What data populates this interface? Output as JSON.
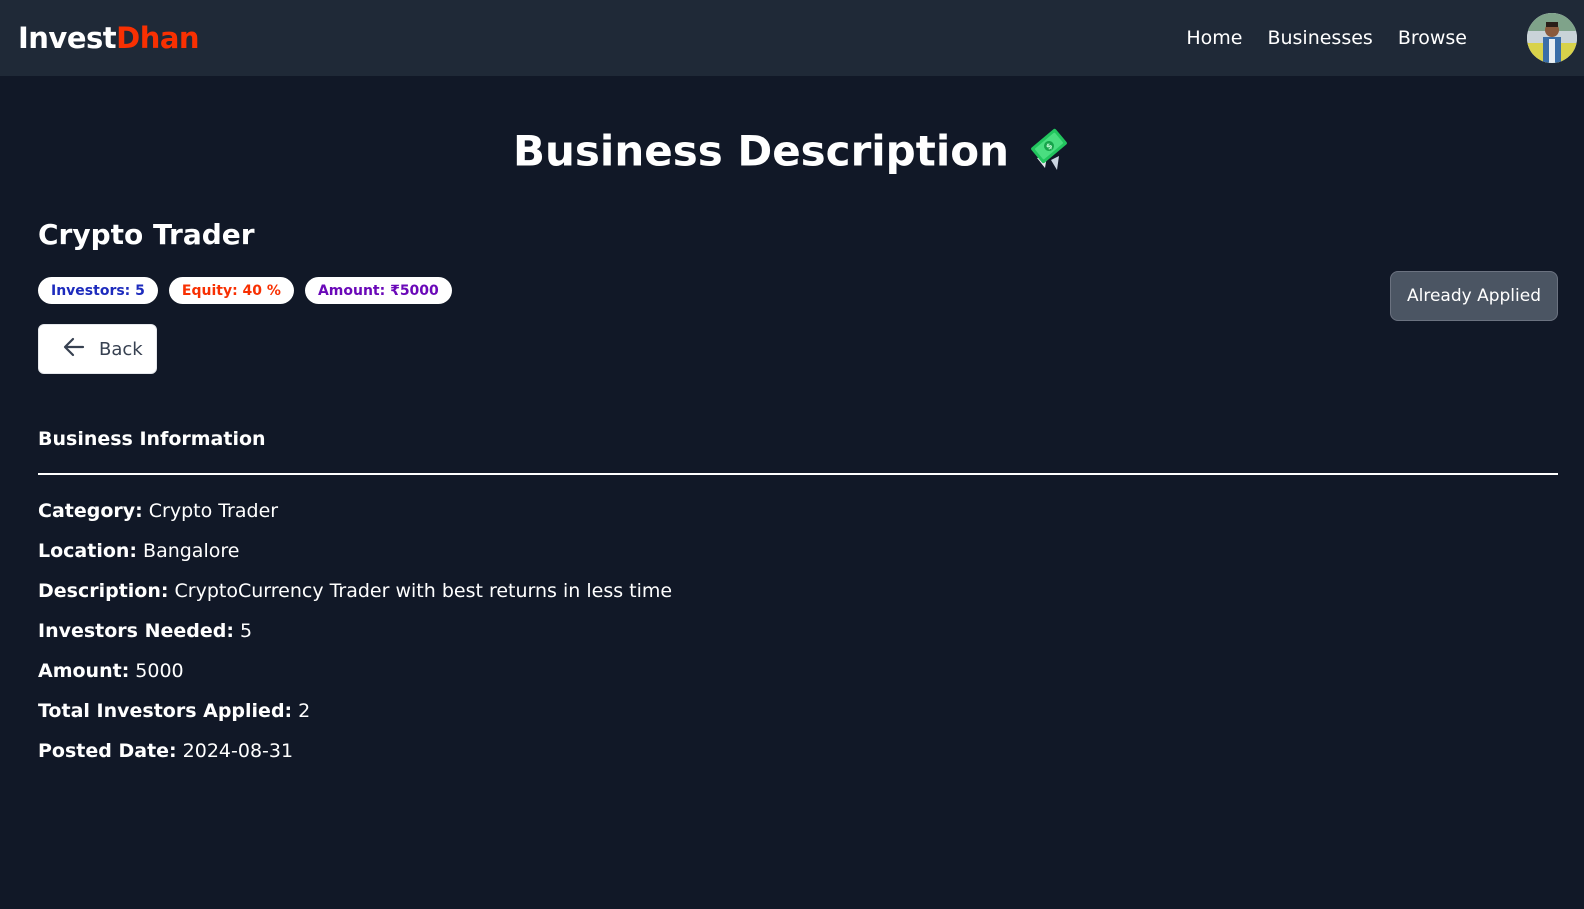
{
  "navbar": {
    "logo_part1": "Invest",
    "logo_part2": "Dhan",
    "links": [
      "Home",
      "Businesses",
      "Browse"
    ]
  },
  "page": {
    "title": "Business Description",
    "title_icon": "money-with-wings-icon"
  },
  "business": {
    "name": "Crypto Trader",
    "badges": {
      "investors": "Investors: 5",
      "equity": "Equity: 40 %",
      "amount": "Amount: ₹5000"
    },
    "back_label": "Back",
    "apply_label": "Already Applied"
  },
  "info": {
    "section_title": "Business Information",
    "rows": [
      {
        "label": "Category:",
        "value": "Crypto Trader"
      },
      {
        "label": "Location:",
        "value": "Bangalore"
      },
      {
        "label": "Description:",
        "value": "CryptoCurrency Trader with best returns in less time"
      },
      {
        "label": "Investors Needed:",
        "value": "5"
      },
      {
        "label": "Amount:",
        "value": "5000"
      },
      {
        "label": "Total Investors Applied:",
        "value": "2"
      },
      {
        "label": "Posted Date:",
        "value": "2024-08-31"
      }
    ]
  },
  "colors": {
    "background": "#111827",
    "navbar": "#1f2937",
    "accent": "#f83002",
    "badge_blue": "#1d2bbd",
    "badge_purple": "#6a08b8",
    "applied_button": "#4b5563"
  }
}
